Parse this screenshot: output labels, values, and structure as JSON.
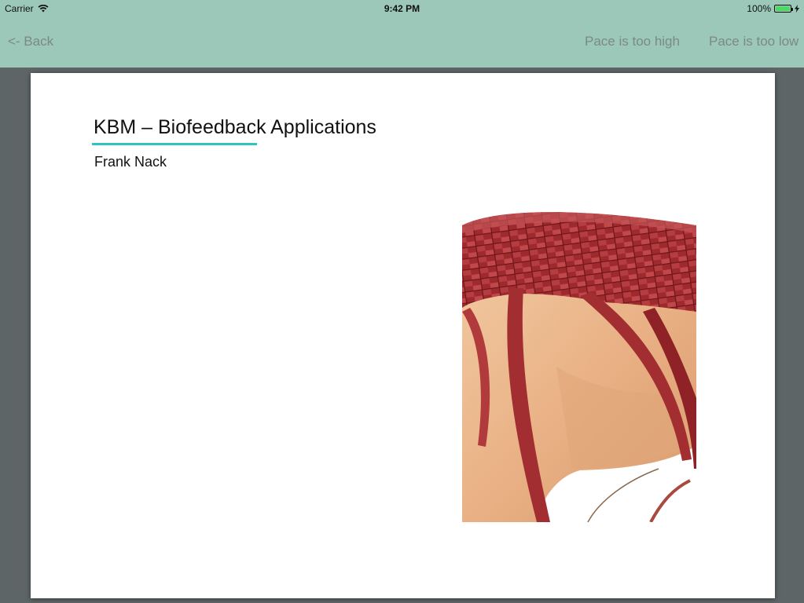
{
  "status_bar": {
    "carrier": "Carrier",
    "time": "9:42 PM",
    "battery": "100%",
    "wifi_icon": "wifi-icon",
    "battery_icon": "battery-icon",
    "charging_icon": "charging-bolt-icon"
  },
  "nav": {
    "back_label": "<- Back",
    "pace_high_label": "Pace is too high",
    "pace_low_label": "Pace is too low"
  },
  "slide": {
    "title": "KBM – Biofeedback Applications",
    "author": "Frank Nack",
    "image_description": "photo-woven-red-fabric-on-body"
  },
  "colors": {
    "topbar": "#9bc8b8",
    "background": "#5e6567",
    "accent_underline": "#2ec4c4",
    "nav_text": "#7b8a86"
  }
}
